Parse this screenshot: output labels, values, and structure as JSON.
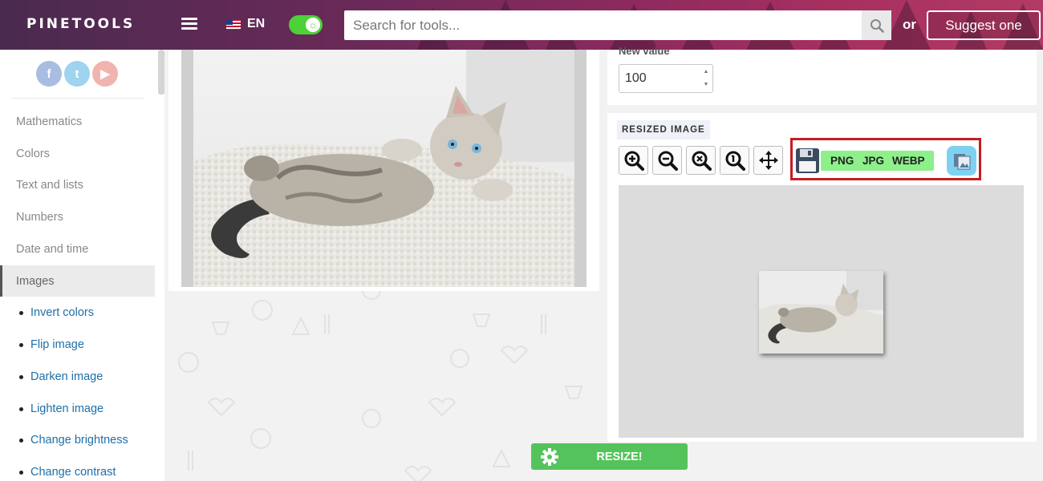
{
  "header": {
    "logo": "PINETOOLS",
    "language": "EN",
    "search_placeholder": "Search for tools...",
    "or_label": "or",
    "suggest_label": "Suggest one"
  },
  "sidebar": {
    "social": [
      {
        "name": "facebook",
        "glyph": "f"
      },
      {
        "name": "twitter",
        "glyph": "t"
      },
      {
        "name": "youtube",
        "glyph": "▶"
      }
    ],
    "categories": [
      "Mathematics",
      "Colors",
      "Text and lists",
      "Numbers",
      "Date and time",
      "Images"
    ],
    "active_category": "Images",
    "image_tools": [
      "Invert colors",
      "Flip image",
      "Darken image",
      "Lighten image",
      "Change brightness",
      "Change contrast"
    ]
  },
  "options": {
    "new_value_label": "New value",
    "new_value": "100"
  },
  "result": {
    "title": "RESIZED IMAGE",
    "zoom_tools": [
      "zoom-in-icon",
      "zoom-out-icon",
      "zoom-reset-icon",
      "zoom-fit-icon",
      "move-icon"
    ],
    "formats": [
      "PNG",
      "JPG",
      "WEBP"
    ]
  },
  "actions": {
    "resize_label": "RESIZE!"
  },
  "colors": {
    "accent_green": "#55c35c",
    "format_bar": "#8ef08a",
    "highlight_red": "#c61b24",
    "link_blue": "#1e6fa8"
  }
}
